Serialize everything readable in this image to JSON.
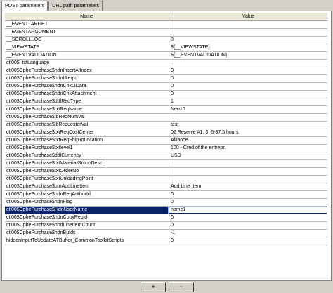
{
  "tabs": [
    "POST parameters",
    "URL path parameters"
  ],
  "columns": {
    "name": "Name",
    "value": "Value"
  },
  "rows": [
    {
      "name": "__EVENTTARGET",
      "value": ""
    },
    {
      "name": "__EVENTARGUMENT",
      "value": ""
    },
    {
      "name": "__SCROLLLOC",
      "value": "0"
    },
    {
      "name": "__VIEWSTATE",
      "value": "${__VIEWSTATE}"
    },
    {
      "name": "__EVENTVALIDATION",
      "value": "${__EVENTVALIDATION}"
    },
    {
      "name": "ctl00$_txtLanguage",
      "value": ""
    },
    {
      "name": "ctl00$CphePurchase$hdnInsertAtIndex",
      "value": "0"
    },
    {
      "name": "ctl00$CphePurchase$hdnIReqId",
      "value": "0"
    },
    {
      "name": "ctl00$CphePurchase$hdnChkLIData",
      "value": "0"
    },
    {
      "name": "ctl00$CphePurchase$hdnChkAttachment",
      "value": "0"
    },
    {
      "name": "ctl00$CphePurchase$ddlReqType",
      "value": "1"
    },
    {
      "name": "ctl00$CphePurchase$txtReqName",
      "value": "Neo10"
    },
    {
      "name": "ctl00$CphePurchase$lbReqNumVal",
      "value": ""
    },
    {
      "name": "ctl00$CphePurchase$lbRequesterVal",
      "value": "test"
    },
    {
      "name": "ctl00$CphePurchase$txtReqCostCenter",
      "value": "02 Reserve #1, 3, 6-37.5 hours"
    },
    {
      "name": "ctl00$CphePurchase$txtReqShipToLocation",
      "value": "Alliance"
    },
    {
      "name": "ctl00$CphePurchase$txtlevel1",
      "value": "100 - Cred.of the entrepr."
    },
    {
      "name": "ctl00$CphePurchase$ddlCurrency",
      "value": "USD"
    },
    {
      "name": "ctl00$CphePurchase$txtMaterialGroupDesc",
      "value": ""
    },
    {
      "name": "ctl00$CphePurchase$txtOrderNo",
      "value": ""
    },
    {
      "name": "ctl00$CphePurchase$txtUnloadingPoint",
      "value": ""
    },
    {
      "name": "ctl00$CphePurchase$btnAddLineItem",
      "value": "Add Line Item"
    },
    {
      "name": "ctl00$CphePurchase$hdnReqAuthorId",
      "value": "0"
    },
    {
      "name": "ctl00$CphePurchase$hdnFlag",
      "value": "0"
    },
    {
      "name": "ctl00$CphePurchase$HdnUserName",
      "value": "name1"
    },
    {
      "name": "ctl00$CphePurchase$hdnCopyReqid",
      "value": "0"
    },
    {
      "name": "ctl00$CphePurchase$hndLineItemCount",
      "value": "0"
    },
    {
      "name": "ctl00$CphePurchase$hdnBuIds",
      "value": "-1"
    },
    {
      "name": "hiddenInputToUpdateATBuffer_CommonToolkitScripts",
      "value": "0"
    }
  ],
  "selected_row": 24,
  "buttons": {
    "add": "+",
    "remove": "−"
  }
}
